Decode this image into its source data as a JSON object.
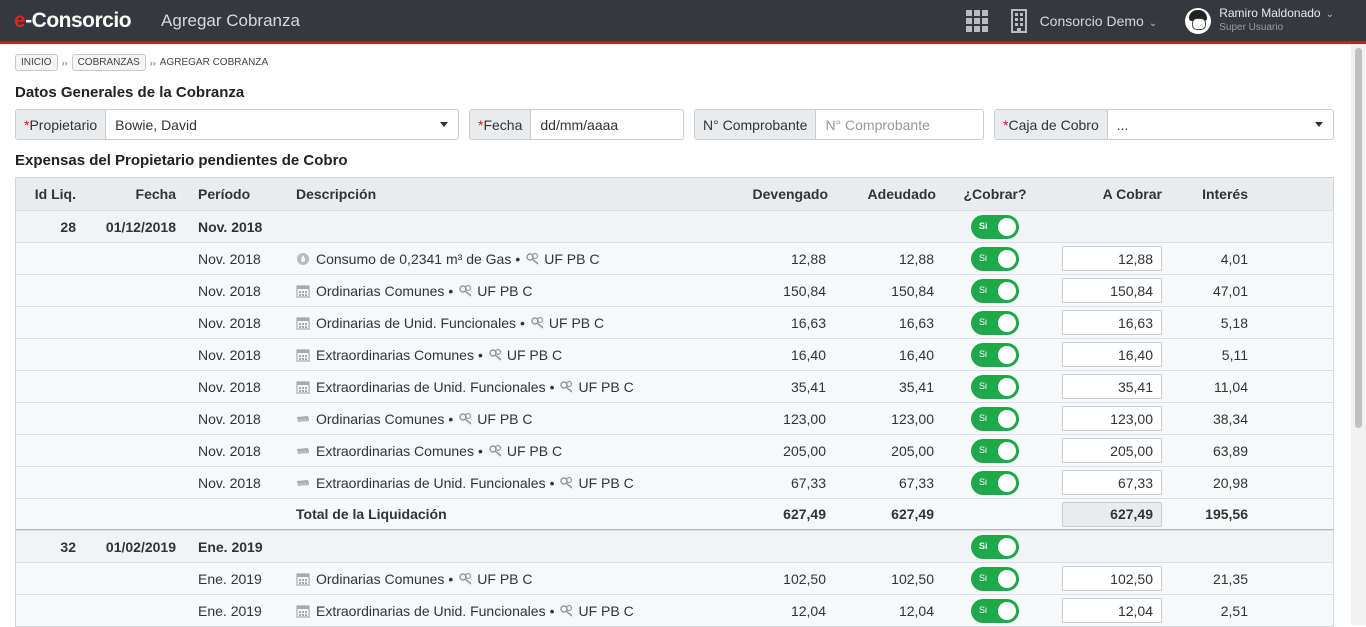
{
  "navbar": {
    "brand_e": "e",
    "brand_rest": "-Consorcio",
    "page_title": "Agregar Cobranza",
    "consorcio": "Consorcio Demo",
    "user_name": "Ramiro Maldonado",
    "user_role": "Super Usuario",
    "caret": "⌄"
  },
  "breadcrumb": {
    "items": [
      "INICIO",
      "COBRANZAS"
    ],
    "current": "AGREGAR COBRANZA",
    "separator": "››"
  },
  "sections": {
    "datos_generales": "Datos Generales de la Cobranza",
    "expensas": "Expensas del Propietario pendientes de Cobro"
  },
  "form": {
    "required_mark": "*",
    "propietario_label": "Propietario",
    "propietario_value": "Bowie, David",
    "fecha_label": "Fecha",
    "fecha_placeholder": "dd/mm/aaaa",
    "comprobante_label": "N° Comprobante",
    "comprobante_placeholder": "N° Comprobante",
    "caja_label": "Caja de Cobro",
    "caja_value": "..."
  },
  "table": {
    "headers": {
      "id": "Id Liq.",
      "fecha": "Fecha",
      "periodo": "Período",
      "descripcion": "Descripción",
      "devengado": "Devengado",
      "adeudado": "Adeudado",
      "cobrar": "¿Cobrar?",
      "a_cobrar": "A Cobrar",
      "interes": "Interés"
    },
    "toggle_label": "Si",
    "unit": "UF PB C",
    "bullet": "•",
    "groups": [
      {
        "id": "28",
        "fecha": "01/12/2018",
        "periodo": "Nov. 2018",
        "items": [
          {
            "periodo": "Nov. 2018",
            "icon": "gas-icon",
            "desc": "Consumo de 0,2341 m³ de Gas",
            "devengado": "12,88",
            "adeudado": "12,88",
            "a_cobrar": "12,88",
            "interes": "4,01"
          },
          {
            "periodo": "Nov. 2018",
            "icon": "calendar-icon",
            "desc": "Ordinarias Comunes",
            "devengado": "150,84",
            "adeudado": "150,84",
            "a_cobrar": "150,84",
            "interes": "47,01"
          },
          {
            "periodo": "Nov. 2018",
            "icon": "calendar-icon",
            "desc": "Ordinarias de Unid. Funcionales",
            "devengado": "16,63",
            "adeudado": "16,63",
            "a_cobrar": "16,63",
            "interes": "5,18"
          },
          {
            "periodo": "Nov. 2018",
            "icon": "calendar-icon",
            "desc": "Extraordinarias Comunes",
            "devengado": "16,40",
            "adeudado": "16,40",
            "a_cobrar": "16,40",
            "interes": "5,11"
          },
          {
            "periodo": "Nov. 2018",
            "icon": "calendar-icon",
            "desc": "Extraordinarias de Unid. Funcionales",
            "devengado": "35,41",
            "adeudado": "35,41",
            "a_cobrar": "35,41",
            "interes": "11,04"
          },
          {
            "periodo": "Nov. 2018",
            "icon": "money-icon",
            "desc": "Ordinarias Comunes",
            "devengado": "123,00",
            "adeudado": "123,00",
            "a_cobrar": "123,00",
            "interes": "38,34"
          },
          {
            "periodo": "Nov. 2018",
            "icon": "money-icon",
            "desc": "Extraordinarias Comunes",
            "devengado": "205,00",
            "adeudado": "205,00",
            "a_cobrar": "205,00",
            "interes": "63,89"
          },
          {
            "periodo": "Nov. 2018",
            "icon": "money-icon",
            "desc": "Extraordinarias de Unid. Funcionales",
            "devengado": "67,33",
            "adeudado": "67,33",
            "a_cobrar": "67,33",
            "interes": "20,98"
          }
        ],
        "total": {
          "label": "Total de la Liquidación",
          "devengado": "627,49",
          "adeudado": "627,49",
          "a_cobrar": "627,49",
          "interes": "195,56"
        }
      },
      {
        "id": "32",
        "fecha": "01/02/2019",
        "periodo": "Ene. 2019",
        "items": [
          {
            "periodo": "Ene. 2019",
            "icon": "calendar-icon",
            "desc": "Ordinarias Comunes",
            "devengado": "102,50",
            "adeudado": "102,50",
            "a_cobrar": "102,50",
            "interes": "21,35"
          },
          {
            "periodo": "Ene. 2019",
            "icon": "calendar-icon",
            "desc": "Extraordinarias de Unid. Funcionales",
            "devengado": "12,04",
            "adeudado": "12,04",
            "a_cobrar": "12,04",
            "interes": "2,51"
          }
        ]
      }
    ]
  }
}
